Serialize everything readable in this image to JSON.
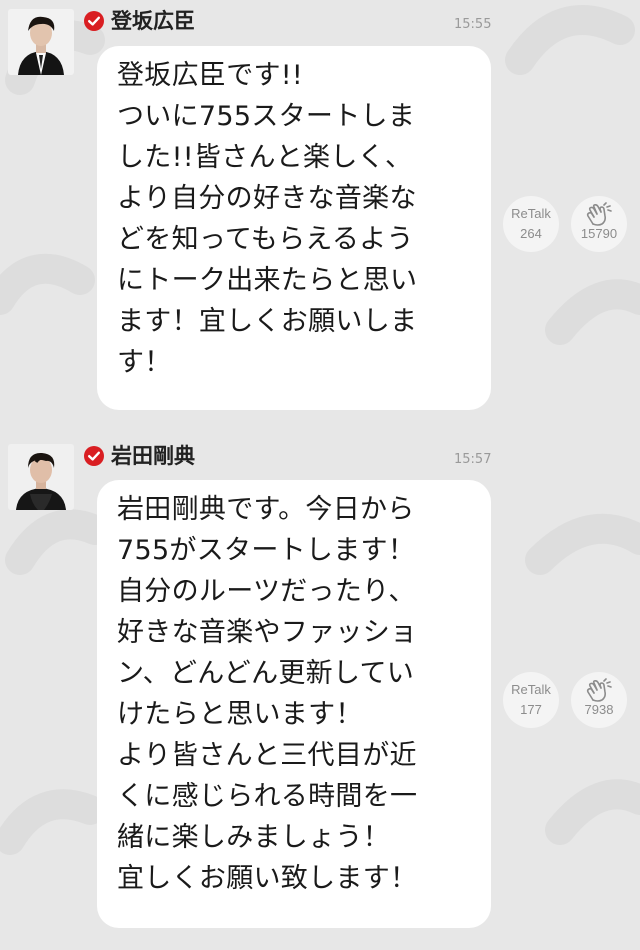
{
  "posts": [
    {
      "author": "登坂広臣",
      "time": "15:55",
      "message": "登坂広臣です!!\nついに755スタートしま\nした!!皆さんと楽しく、\nより自分の好きな音楽な\nどを知ってもらえるよう\nにトーク出来たらと思い\nます！宜しくお願いしま\nす！",
      "retalk_label": "ReTalk",
      "retalk_count": "264",
      "clap_count": "15790"
    },
    {
      "author": "岩田剛典",
      "time": "15:57",
      "message": "岩田剛典です。今日から\n755がスタートします！\n自分のルーツだったり、\n好きな音楽やファッショ\nン、どんどん更新してい\nけたらと思います！\nより皆さんと三代目が近\nくに感じられる時間を一\n緒に楽しみましょう！\n宜しくお願い致します！",
      "retalk_label": "ReTalk",
      "retalk_count": "177",
      "clap_count": "7938"
    }
  ],
  "icons": {
    "verified": "verified-check-icon",
    "clap": "clap-icon"
  },
  "colors": {
    "background": "#e7e7e7",
    "bubble": "#ffffff",
    "verified_red": "#d91e22",
    "button_bg": "#f4f4f4"
  }
}
